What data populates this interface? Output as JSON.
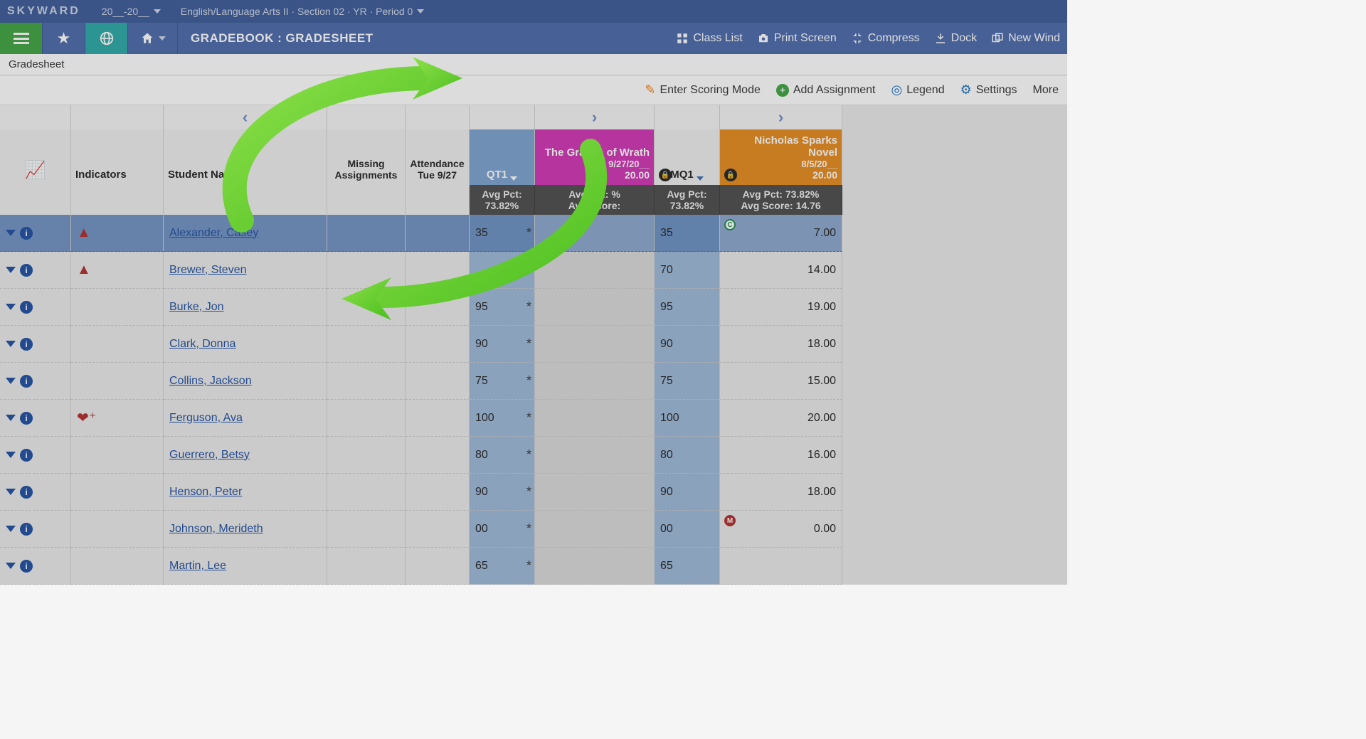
{
  "context": {
    "brand": "SKYWARD",
    "year": "20__-20__",
    "course": "English/Language Arts II · Section 02 · YR · Period 0"
  },
  "nav": {
    "title": "GRADEBOOK : GRADESHEET",
    "actions": {
      "class_list": "Class List",
      "print_screen": "Print Screen",
      "compress": "Compress",
      "dock": "Dock",
      "new_window": "New Wind"
    }
  },
  "sub_title": "Gradesheet",
  "toolbar": {
    "scoring": "Enter Scoring Mode",
    "add_assignment": "Add Assignment",
    "legend": "Legend",
    "settings": "Settings",
    "more": "More"
  },
  "columns": {
    "indicators": "Indicators",
    "student": "Student Name",
    "missing": "Missing Assignments",
    "attendance": "Attendance Tue 9/27",
    "qt1": "QT1",
    "mq1": "MQ1",
    "assign1_title": "The Grapes of Wrath",
    "assign1_date": "9/27/20__",
    "assign1_pts": "20.00",
    "assign2_title": "Nicholas Sparks Novel",
    "assign2_date": "8/5/20__",
    "assign2_pts": "20.00"
  },
  "averages": {
    "qt1_label": "Avg Pct:",
    "qt1_value": "73.82%",
    "a1_pct": "Avg Pct: %",
    "a1_score": "Avg Score:",
    "mq1_label": "Avg Pct:",
    "mq1_value": "73.82%",
    "a2_pct": "Avg Pct: 73.82%",
    "a2_score": "Avg Score: 14.76"
  },
  "students": [
    {
      "name": "Alexander, Casey",
      "indicator": "warn",
      "qt1": "35",
      "mq1": "35",
      "a2": "7.00",
      "a2_badge": "C",
      "selected": true
    },
    {
      "name": "Brewer, Steven",
      "indicator": "warn",
      "qt1": "",
      "mq1": "70",
      "a2": "14.00"
    },
    {
      "name": "Burke, Jon",
      "indicator": "",
      "qt1": "95",
      "mq1": "95",
      "a2": "19.00"
    },
    {
      "name": "Clark, Donna",
      "indicator": "",
      "qt1": "90",
      "mq1": "90",
      "a2": "18.00"
    },
    {
      "name": "Collins, Jackson",
      "indicator": "",
      "qt1": "75",
      "mq1": "75",
      "a2": "15.00"
    },
    {
      "name": "Ferguson, Ava",
      "indicator": "heart",
      "qt1": "100",
      "mq1": "100",
      "a2": "20.00"
    },
    {
      "name": "Guerrero, Betsy",
      "indicator": "",
      "qt1": "80",
      "mq1": "80",
      "a2": "16.00"
    },
    {
      "name": "Henson, Peter",
      "indicator": "",
      "qt1": "90",
      "mq1": "90",
      "a2": "18.00"
    },
    {
      "name": "Johnson, Merideth",
      "indicator": "",
      "qt1": "00",
      "mq1": "00",
      "a2": "0.00",
      "a2_badge": "M"
    },
    {
      "name": "Martin, Lee",
      "indicator": "",
      "qt1": "65",
      "mq1": "65",
      "a2": ""
    }
  ]
}
